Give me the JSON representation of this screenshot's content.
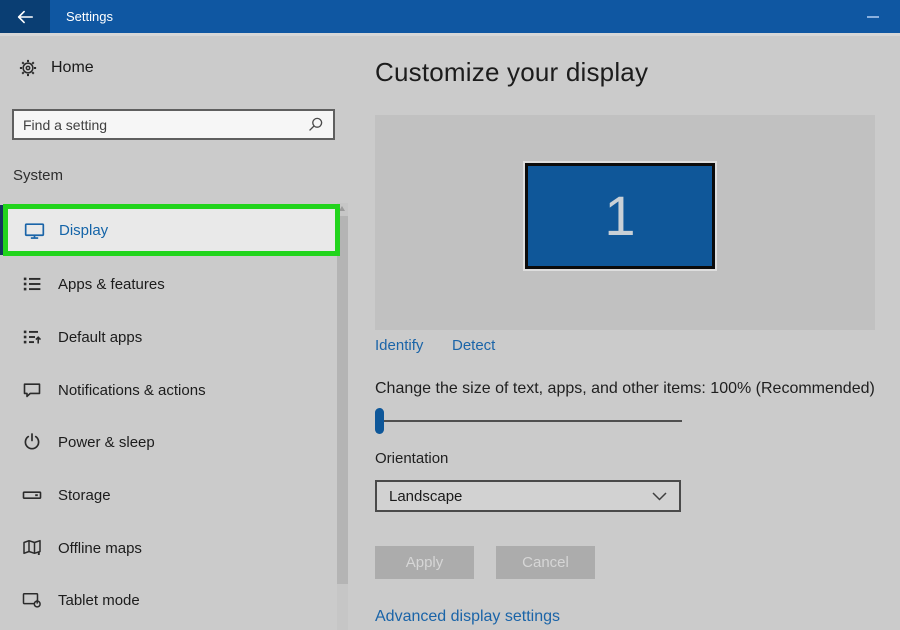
{
  "titlebar": {
    "title": "Settings"
  },
  "sidebar": {
    "home": {
      "label": "Home"
    },
    "search": {
      "placeholder": "Find a setting"
    },
    "section": {
      "header": "System"
    },
    "items": [
      {
        "label": "Display",
        "icon": "display-icon",
        "selected": true
      },
      {
        "label": "Apps & features",
        "icon": "apps-features-icon",
        "selected": false
      },
      {
        "label": "Default apps",
        "icon": "default-apps-icon",
        "selected": false
      },
      {
        "label": "Notifications & actions",
        "icon": "notifications-icon",
        "selected": false
      },
      {
        "label": "Power & sleep",
        "icon": "power-icon",
        "selected": false
      },
      {
        "label": "Storage",
        "icon": "storage-icon",
        "selected": false
      },
      {
        "label": "Offline maps",
        "icon": "offline-maps-icon",
        "selected": false
      },
      {
        "label": "Tablet mode",
        "icon": "tablet-mode-icon",
        "selected": false
      }
    ]
  },
  "main": {
    "title": "Customize your display",
    "preview": {
      "monitor_label": "1"
    },
    "identify_link": "Identify",
    "detect_link": "Detect",
    "scale": {
      "label": "Change the size of text, apps, and other items: 100% (Recommended)",
      "value_percent": 100
    },
    "orientation": {
      "label": "Orientation",
      "value": "Landscape"
    },
    "buttons": {
      "apply": "Apply",
      "cancel": "Cancel"
    },
    "advanced_link": "Advanced display settings"
  },
  "annotation": {
    "highlight_target": "Display",
    "highlight_color": "#22d41c"
  },
  "colors": {
    "titlebar_bg": "#0f57a2",
    "back_button_bg": "#0a3e73",
    "accent_blue": "#1a64a8",
    "monitor_blue": "#0f5799",
    "selected_row_bg": "#e9e9e9",
    "selected_accent_bar": "#15355e",
    "page_bg": "#cbcbcb",
    "panel_bg": "#c1c1c1",
    "highlight_green": "#22d41c"
  }
}
